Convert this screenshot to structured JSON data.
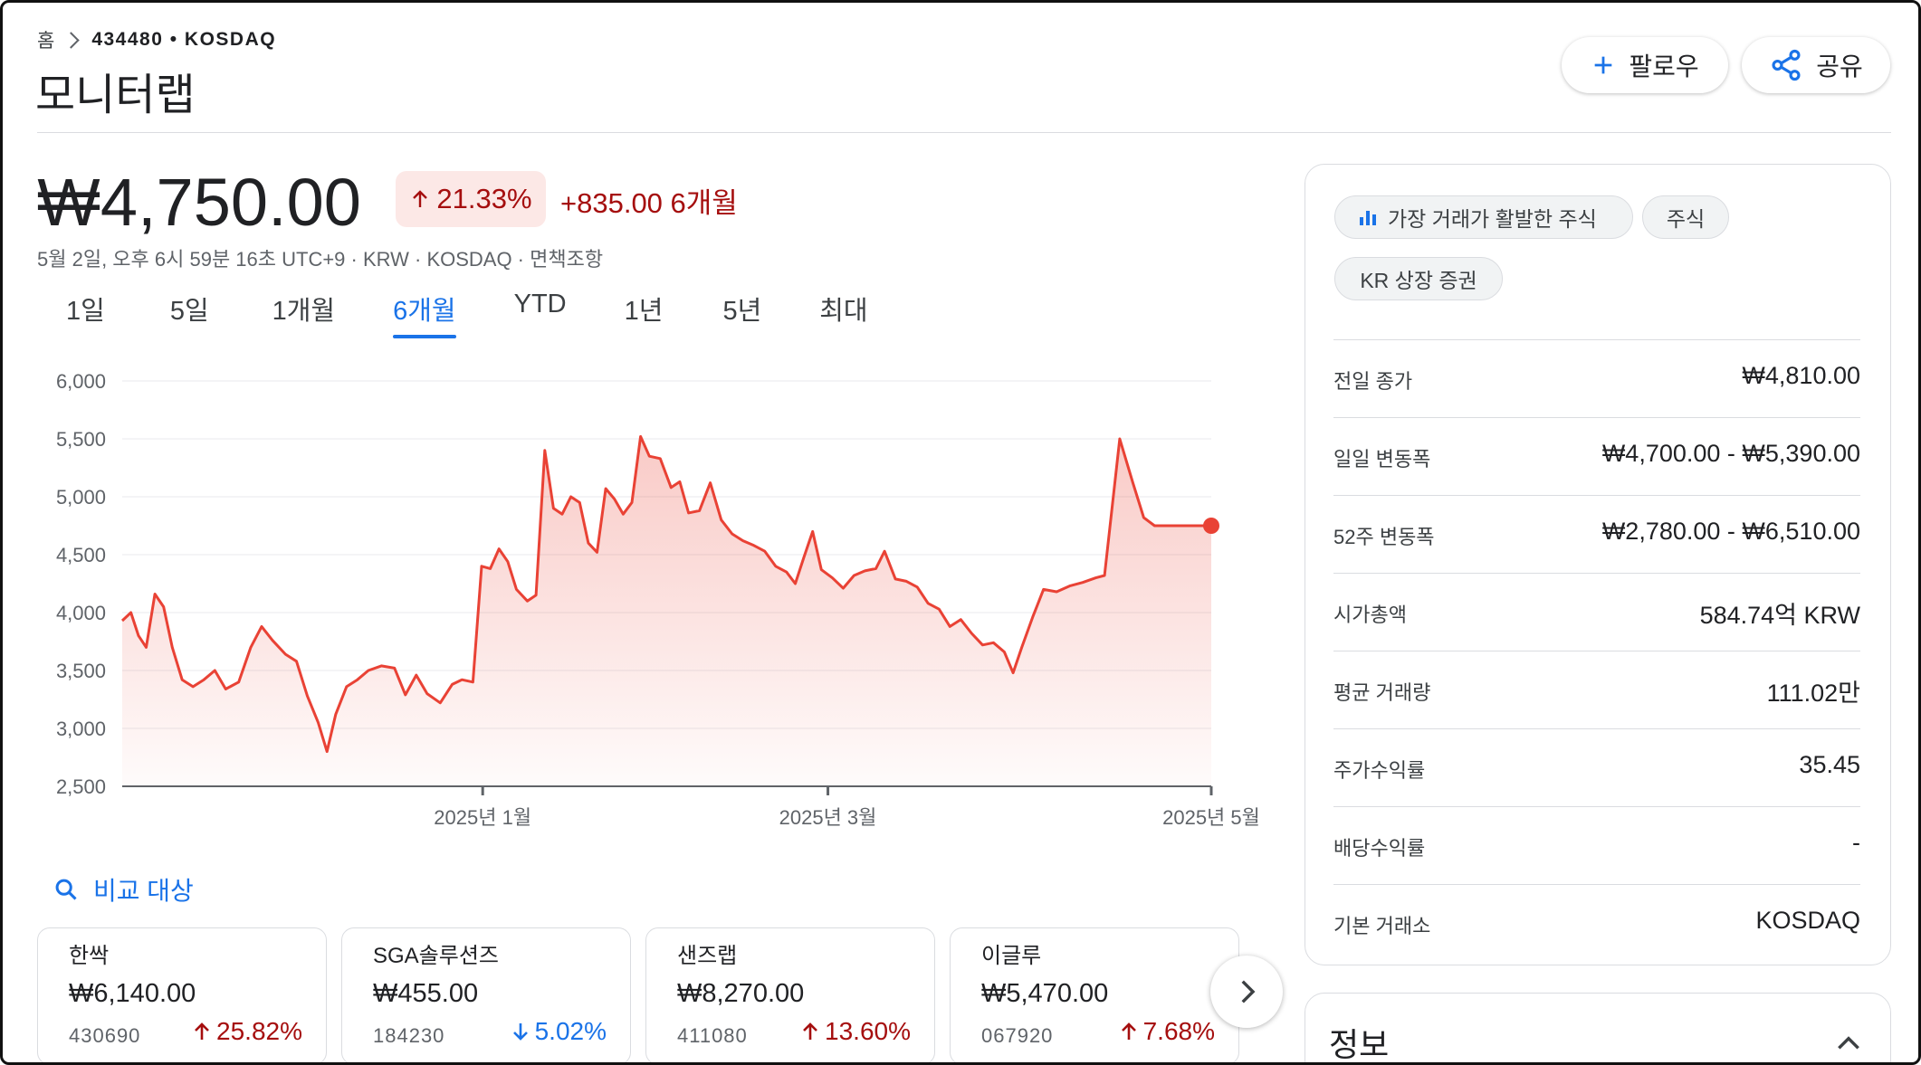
{
  "breadcrumb": {
    "home": "홈",
    "symbol": "434480 • KOSDAQ"
  },
  "title": "모니터랩",
  "header": {
    "follow_label": "팔로우",
    "share_label": "공유"
  },
  "price": {
    "value": "₩4,750.00",
    "pct": "21.33%",
    "change": "+835.00 6개월",
    "meta": "5월 2일, 오후 6시 59분 16초 UTC+9 · KRW · KOSDAQ · 면책조항"
  },
  "tabs": [
    "1일",
    "5일",
    "1개월",
    "6개월",
    "YTD",
    "1년",
    "5년",
    "최대"
  ],
  "active_tab": 3,
  "chart_data": {
    "type": "area",
    "yticks": [
      "6,000",
      "5,500",
      "5,000",
      "4,500",
      "4,000",
      "3,500",
      "3,000",
      "2,500"
    ],
    "ylim": [
      2500,
      6000
    ],
    "xticks": [
      {
        "label": "2025년 1월",
        "t": 0.331
      },
      {
        "label": "2025년 3월",
        "t": 0.648
      },
      {
        "label": "2025년 5월",
        "t": 1.0
      }
    ],
    "series": [
      {
        "color": "#e94235",
        "points": [
          [
            0.0,
            3930
          ],
          [
            0.008,
            4000
          ],
          [
            0.015,
            3800
          ],
          [
            0.022,
            3700
          ],
          [
            0.03,
            4160
          ],
          [
            0.038,
            4050
          ],
          [
            0.046,
            3700
          ],
          [
            0.055,
            3420
          ],
          [
            0.065,
            3360
          ],
          [
            0.075,
            3420
          ],
          [
            0.085,
            3500
          ],
          [
            0.095,
            3340
          ],
          [
            0.107,
            3400
          ],
          [
            0.118,
            3700
          ],
          [
            0.128,
            3880
          ],
          [
            0.138,
            3760
          ],
          [
            0.15,
            3640
          ],
          [
            0.16,
            3580
          ],
          [
            0.17,
            3280
          ],
          [
            0.18,
            3050
          ],
          [
            0.188,
            2800
          ],
          [
            0.196,
            3120
          ],
          [
            0.206,
            3360
          ],
          [
            0.216,
            3420
          ],
          [
            0.226,
            3500
          ],
          [
            0.238,
            3540
          ],
          [
            0.25,
            3520
          ],
          [
            0.26,
            3290
          ],
          [
            0.27,
            3460
          ],
          [
            0.28,
            3300
          ],
          [
            0.292,
            3220
          ],
          [
            0.303,
            3380
          ],
          [
            0.312,
            3420
          ],
          [
            0.322,
            3400
          ],
          [
            0.33,
            4400
          ],
          [
            0.338,
            4380
          ],
          [
            0.346,
            4550
          ],
          [
            0.354,
            4440
          ],
          [
            0.362,
            4200
          ],
          [
            0.372,
            4100
          ],
          [
            0.38,
            4150
          ],
          [
            0.388,
            5400
          ],
          [
            0.396,
            4900
          ],
          [
            0.404,
            4850
          ],
          [
            0.412,
            5000
          ],
          [
            0.42,
            4950
          ],
          [
            0.428,
            4600
          ],
          [
            0.436,
            4520
          ],
          [
            0.444,
            5070
          ],
          [
            0.452,
            4980
          ],
          [
            0.46,
            4850
          ],
          [
            0.468,
            4950
          ],
          [
            0.476,
            5520
          ],
          [
            0.484,
            5350
          ],
          [
            0.494,
            5330
          ],
          [
            0.504,
            5080
          ],
          [
            0.512,
            5130
          ],
          [
            0.52,
            4860
          ],
          [
            0.53,
            4880
          ],
          [
            0.54,
            5120
          ],
          [
            0.55,
            4800
          ],
          [
            0.56,
            4680
          ],
          [
            0.57,
            4620
          ],
          [
            0.58,
            4580
          ],
          [
            0.59,
            4530
          ],
          [
            0.6,
            4400
          ],
          [
            0.61,
            4350
          ],
          [
            0.618,
            4250
          ],
          [
            0.626,
            4480
          ],
          [
            0.634,
            4700
          ],
          [
            0.642,
            4370
          ],
          [
            0.652,
            4300
          ],
          [
            0.662,
            4210
          ],
          [
            0.672,
            4320
          ],
          [
            0.682,
            4360
          ],
          [
            0.692,
            4380
          ],
          [
            0.7,
            4530
          ],
          [
            0.71,
            4290
          ],
          [
            0.72,
            4270
          ],
          [
            0.73,
            4220
          ],
          [
            0.74,
            4080
          ],
          [
            0.75,
            4030
          ],
          [
            0.76,
            3880
          ],
          [
            0.77,
            3940
          ],
          [
            0.78,
            3820
          ],
          [
            0.79,
            3720
          ],
          [
            0.8,
            3740
          ],
          [
            0.81,
            3660
          ],
          [
            0.818,
            3480
          ],
          [
            0.826,
            3700
          ],
          [
            0.836,
            3960
          ],
          [
            0.846,
            4200
          ],
          [
            0.858,
            4180
          ],
          [
            0.87,
            4230
          ],
          [
            0.882,
            4260
          ],
          [
            0.894,
            4300
          ],
          [
            0.902,
            4320
          ],
          [
            0.916,
            5500
          ],
          [
            0.928,
            5120
          ],
          [
            0.938,
            4820
          ],
          [
            0.948,
            4750
          ],
          [
            1.0,
            4750
          ]
        ]
      }
    ],
    "last_point": {
      "t": 1.0,
      "value": 4750
    }
  },
  "compare": {
    "label": "비교 대상",
    "cards": [
      {
        "name": "한싹",
        "price": "₩6,140.00",
        "code": "430690",
        "pct": "25.82%",
        "dir": "up"
      },
      {
        "name": "SGA솔루션즈",
        "price": "₩455.00",
        "code": "184230",
        "pct": "5.02%",
        "dir": "down"
      },
      {
        "name": "샌즈랩",
        "price": "₩8,270.00",
        "code": "411080",
        "pct": "13.60%",
        "dir": "up"
      },
      {
        "name": "이글루",
        "price": "₩5,470.00",
        "code": "067920",
        "pct": "7.68%",
        "dir": "up"
      }
    ]
  },
  "panel": {
    "chips": [
      "가장 거래가 활발한 주식",
      "주식",
      "KR 상장 증권"
    ],
    "stats": [
      {
        "label": "전일 종가",
        "value": "₩4,810.00"
      },
      {
        "label": "일일 변동폭",
        "value": "₩4,700.00 - ₩5,390.00"
      },
      {
        "label": "52주 변동폭",
        "value": "₩2,780.00 - ₩6,510.00"
      },
      {
        "label": "시가총액",
        "value": "584.74억 KRW"
      },
      {
        "label": "평균 거래량",
        "value": "111.02만"
      },
      {
        "label": "주가수익률",
        "value": "35.45"
      },
      {
        "label": "배당수익률",
        "value": "-"
      },
      {
        "label": "기본 거래소",
        "value": "KOSDAQ"
      }
    ],
    "info_title": "정보"
  },
  "colors": {
    "up": "#a50e0e",
    "down": "#1a73e8",
    "accent": "#1a73e8",
    "line": "#e94235"
  }
}
